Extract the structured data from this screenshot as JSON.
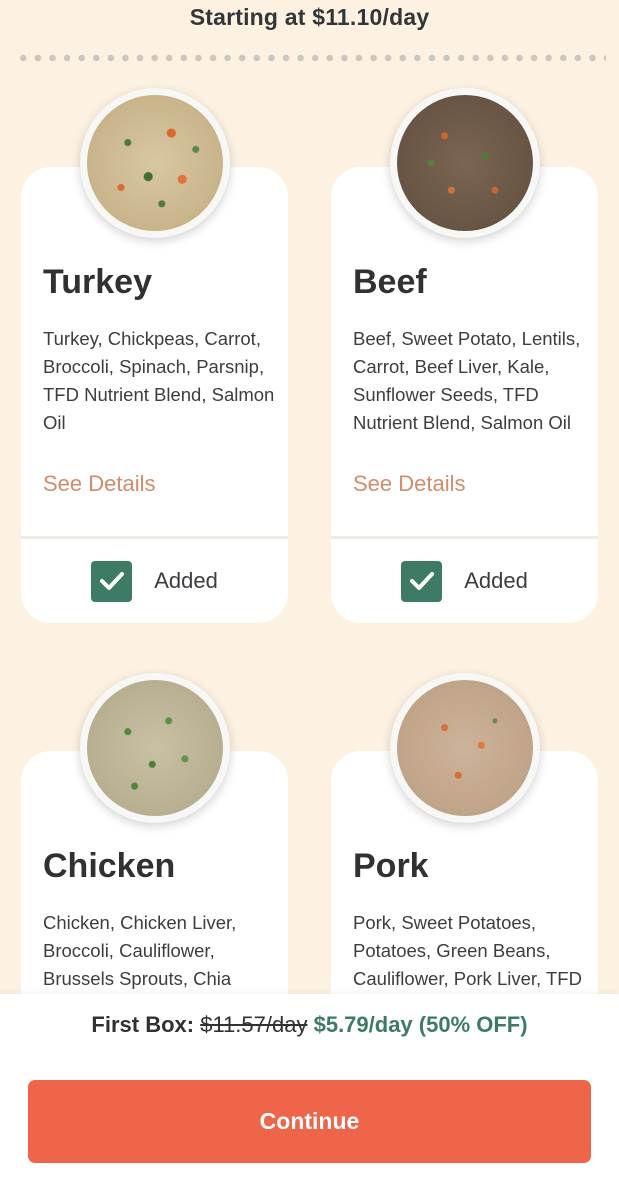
{
  "header": {
    "price_text": "Starting at $11.10/day"
  },
  "recipes": [
    {
      "name": "Turkey",
      "ingredients": "Turkey, Chickpeas, Carrot, Broccoli, Spinach, Parsnip, TFD Nutrient Blend, Salmon Oil",
      "details_label": "See Details",
      "status_label": "Added",
      "image_icon": "turkey-bowl-image"
    },
    {
      "name": "Beef",
      "ingredients": "Beef, Sweet Potato, Lentils, Carrot, Beef Liver, Kale, Sunflower Seeds, TFD Nutrient Blend, Salmon Oil",
      "details_label": "See Details",
      "status_label": "Added",
      "image_icon": "beef-bowl-image"
    },
    {
      "name": "Chicken",
      "ingredients": "Chicken, Chicken Liver, Broccoli, Cauliflower, Brussels Sprouts, Chia",
      "image_icon": "chicken-bowl-image"
    },
    {
      "name": "Pork",
      "ingredients": "Pork, Sweet Potatoes, Potatoes, Green Beans, Cauliflower, Pork Liver, TFD",
      "image_icon": "pork-bowl-image"
    }
  ],
  "footer": {
    "first_box_label": "First Box:",
    "old_price": "$11.57/day",
    "new_price": "$5.79/day (50% OFF)",
    "continue_label": "Continue"
  },
  "colors": {
    "background": "#fdf2e2",
    "accent_green": "#3e7b64",
    "details_link": "#d28c6c",
    "cta": "#ef6549"
  }
}
